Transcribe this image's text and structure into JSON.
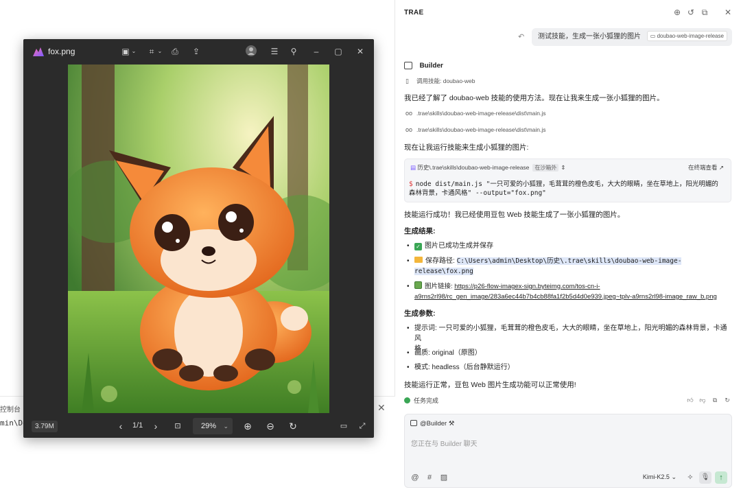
{
  "console": {
    "title": "控制台",
    "line": "min\\De"
  },
  "viewer": {
    "filename": "fox.png",
    "file_size": "3.79M",
    "page_counter": "1/1",
    "zoom": "29%"
  },
  "panel": {
    "title": "TRAE",
    "user_message": "测试技能，生成一张小狐狸的图片",
    "user_tag": "doubao-web-image-release",
    "agent_name": "Builder",
    "invoke_skill": "调用技能: doubao-web",
    "intro": "我已经了解了 doubao-web 技能的使用方法。现在让我来生成一张小狐狸的图片。",
    "file_ref_1": ".trae\\skills\\doubao-web-image-release\\dist\\main.js",
    "file_ref_2": ".trae\\skills\\doubao-web-image-release\\dist\\main.js",
    "run_intro": "现在让我运行技能来生成小狐狸的图片:",
    "code": {
      "path": "历史\\.trae\\skills\\doubao-web-image-release",
      "sandbox": "在沙箱外",
      "online": "在终端查看",
      "command": "node dist/main.js \"一只可爱的小狐狸，毛茸茸的橙色皮毛，大大的眼睛，坐在草地上，阳光明媚的森林背景，卡通风格\" --output=\"fox.png\""
    },
    "success": "技能运行成功！我已经使用豆包 Web 技能生成了一张小狐狸的图片。",
    "result_heading": "生成结果:",
    "result_saved": "图片已成功生成并保存",
    "result_path_label": "保存路径:",
    "result_path_1": "C:\\Users\\admin\\Desktop\\历史\\.trae\\skills\\doubao-web-image-",
    "result_path_2": "release\\fox.png",
    "result_link_label": "图片链接:",
    "result_link_1": "https://p26-flow-imagex-sign.byteimg.com/tos-cn-i-",
    "result_link_2": "a9rns2rl98/rc_gen_image/283a6ec44b7b4cb88fa1f2b5d4d0e939.jpeg~tplv-a9rns2rl98-image_raw_b.png",
    "params_heading": "生成参数:",
    "param_prompt_1": "提示词: 一只可爱的小狐狸，毛茸茸的橙色皮毛，大大的眼睛，坐在草地上，阳光明媚的森林背景，卡通风",
    "param_prompt_2": "格",
    "param_quality": "画质: original（原图）",
    "param_mode": "模式: headless（后台静默运行）",
    "closing": "技能运行正常，豆包 Web 图片生成功能可以正常使用!",
    "task_done": "任务完成",
    "input": {
      "mention": "@Builder",
      "placeholder": "您正在与 Builder 聊天",
      "model": "Kimi-K2.5"
    }
  },
  "colors": {
    "accent_green": "#3aa655",
    "highlight": "#dde6f7",
    "viewer_bg": "#2b2b2b"
  }
}
